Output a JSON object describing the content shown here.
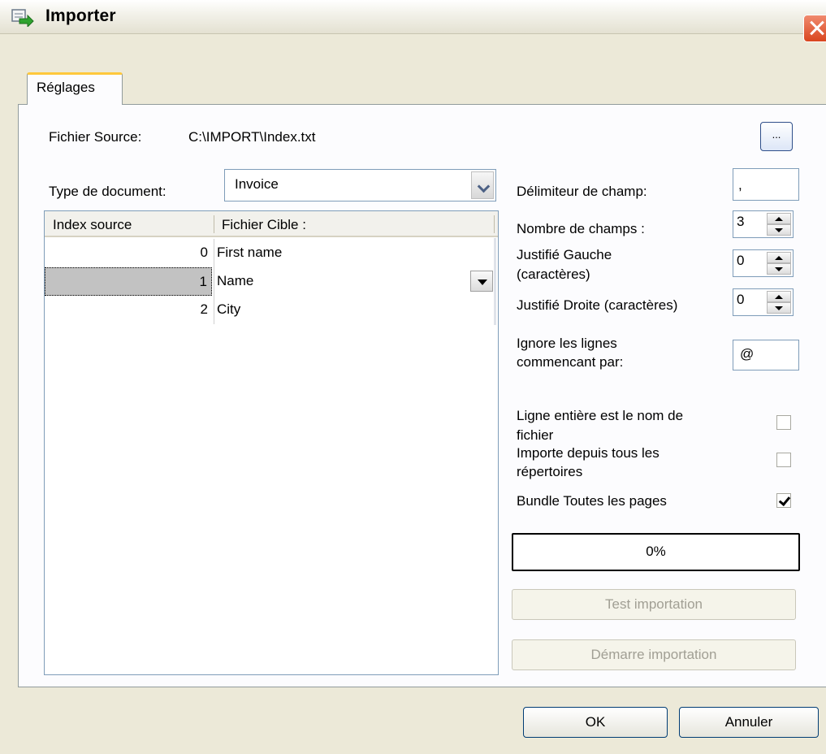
{
  "window": {
    "title": "Importer",
    "icon": "import-arrow-icon",
    "close": "close-icon"
  },
  "tabs": [
    {
      "label": "Réglages",
      "active": true
    }
  ],
  "source": {
    "label": "Fichier Source:",
    "path": "C:\\IMPORT\\Index.txt",
    "browse_label": "..."
  },
  "doc_type": {
    "label": "Type de document:",
    "value": "Invoice"
  },
  "grid": {
    "columns": [
      "Index source",
      "Fichier Cible :"
    ],
    "rows": [
      {
        "index": "0",
        "target": "First name",
        "selected": false
      },
      {
        "index": "1",
        "target": "Name",
        "selected": true
      },
      {
        "index": "2",
        "target": "City",
        "selected": false
      }
    ]
  },
  "settings": {
    "delimiter_label": "Délimiteur de champ:",
    "delimiter_value": ",",
    "num_fields_label": "Nombre de champs :",
    "num_fields_value": "3",
    "left_just_label_1": "Justifié Gauche",
    "left_just_label_2": "(caractères)",
    "left_just_value": "0",
    "right_just_label": "Justifié Droite (caractères)",
    "right_just_value": "0",
    "ignore_label_1": "Ignore les lignes",
    "ignore_label_2": "commencant par:",
    "ignore_value": "@",
    "whole_line_label_1": "Ligne entière est le nom de",
    "whole_line_label_2": "fichier",
    "whole_line_checked": false,
    "all_dirs_label_1": "Importe depuis tous les",
    "all_dirs_label_2": "répertoires",
    "all_dirs_checked": false,
    "bundle_label": "Bundle Toutes les pages",
    "bundle_checked": true
  },
  "progress": {
    "text": "0%",
    "value": 0
  },
  "actions": {
    "test_label": "Test importation",
    "start_label": "Démarre importation"
  },
  "footer": {
    "ok_label": "OK",
    "cancel_label": "Annuler"
  }
}
